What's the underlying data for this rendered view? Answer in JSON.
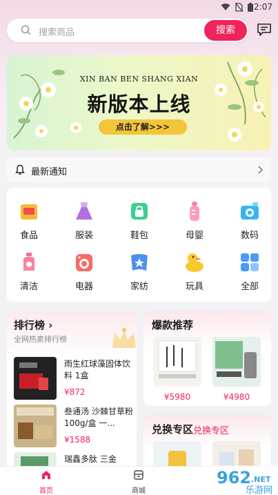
{
  "status_bar": {
    "time": "2:07"
  },
  "search": {
    "placeholder": "搜索商品",
    "button_label": "搜索"
  },
  "banner": {
    "subtitle": "XIN BAN BEN SHANG XIAN",
    "title": "新版本上线",
    "cta": "点击了解>>>"
  },
  "notice": {
    "label": "最新通知"
  },
  "categories": [
    {
      "label": "食品",
      "icon": "food-icon"
    },
    {
      "label": "服装",
      "icon": "clothing-icon"
    },
    {
      "label": "鞋包",
      "icon": "shoes-bags-icon"
    },
    {
      "label": "母婴",
      "icon": "baby-bottle-icon"
    },
    {
      "label": "数码",
      "icon": "camera-icon"
    },
    {
      "label": "清洁",
      "icon": "cleaning-icon"
    },
    {
      "label": "电器",
      "icon": "appliance-icon"
    },
    {
      "label": "家纺",
      "icon": "home-textile-icon"
    },
    {
      "label": "玩具",
      "icon": "duck-toy-icon"
    },
    {
      "label": "全部",
      "icon": "grid-all-icon"
    }
  ],
  "ranking": {
    "title": "排行榜",
    "subtitle": "全网热卖排行榜",
    "items": [
      {
        "name": "雨生红球藻固体饮料 1盒",
        "price": "¥872"
      },
      {
        "name": "叁通汤 沙棘甘草粉 100g/盒 一...",
        "price": "¥1588"
      },
      {
        "name": "瑞鑫多肽 三金",
        "price": ""
      }
    ]
  },
  "hot": {
    "title": "爆款推荐",
    "items": [
      {
        "price": "¥5980"
      },
      {
        "price": "¥4980"
      }
    ]
  },
  "exchange": {
    "title": "兑换专区",
    "tag": "兑换专区"
  },
  "tabbar": [
    {
      "label": "首页",
      "active": true
    },
    {
      "label": "商城",
      "active": false
    }
  ],
  "watermark": {
    "brand": "962.NET",
    "text": "乐游网"
  },
  "colors": {
    "accent": "#f0245c",
    "banner_cta": "#f4c43a"
  }
}
